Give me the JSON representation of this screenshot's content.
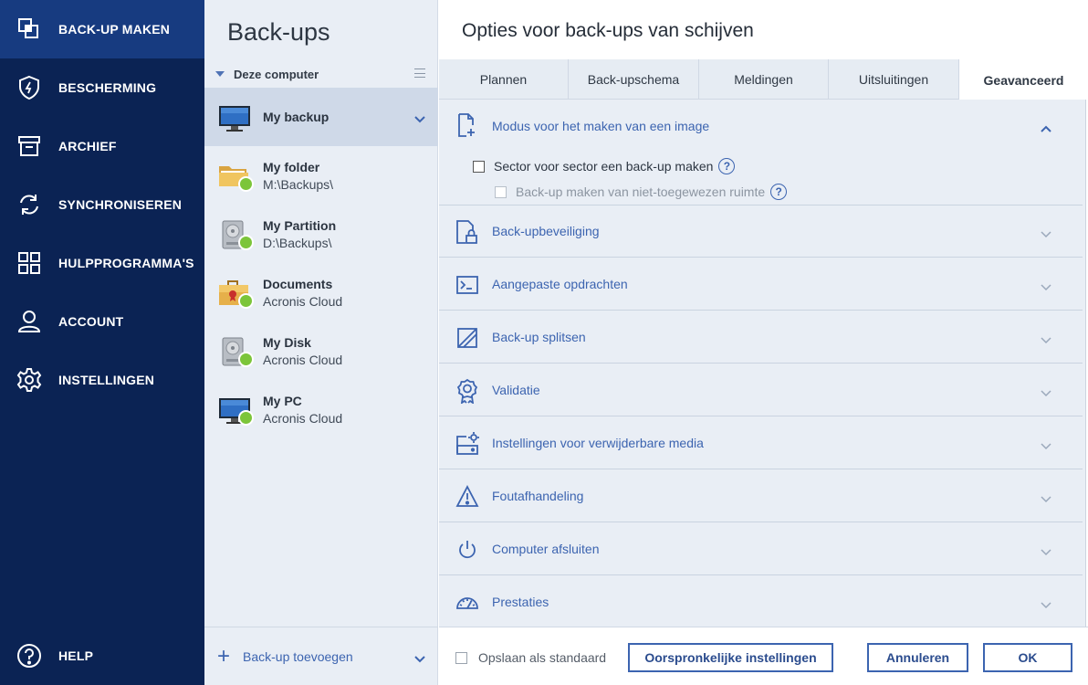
{
  "nav": {
    "items": [
      {
        "label": "BACK-UP MAKEN",
        "icon": "copy-icon",
        "active": true
      },
      {
        "label": "BESCHERMING",
        "icon": "shield-icon",
        "active": false
      },
      {
        "label": "ARCHIEF",
        "icon": "archive-box-icon",
        "active": false
      },
      {
        "label": "SYNCHRONISEREN",
        "icon": "sync-icon",
        "active": false
      },
      {
        "label": "HULPPROGRAMMA'S",
        "icon": "tools-grid-icon",
        "active": false
      },
      {
        "label": "ACCOUNT",
        "icon": "user-icon",
        "active": false
      },
      {
        "label": "INSTELLINGEN",
        "icon": "gear-icon",
        "active": false
      }
    ],
    "help": {
      "label": "HELP",
      "icon": "help-circle-icon"
    }
  },
  "backups": {
    "title": "Back-ups",
    "group": "Deze computer",
    "items": [
      {
        "name": "My backup",
        "sub": "",
        "icon": "monitor-icon",
        "selected": true
      },
      {
        "name": "My folder",
        "sub": "M:\\Backups\\",
        "icon": "folder-icon",
        "selected": false
      },
      {
        "name": "My Partition",
        "sub": "D:\\Backups\\",
        "icon": "disk-icon",
        "selected": false
      },
      {
        "name": "Documents",
        "sub": "Acronis Cloud",
        "icon": "briefcase-icon",
        "selected": false
      },
      {
        "name": "My Disk",
        "sub": "Acronis Cloud",
        "icon": "disk-icon",
        "selected": false
      },
      {
        "name": "My PC",
        "sub": "Acronis Cloud",
        "icon": "monitor-icon",
        "selected": false
      }
    ],
    "add_label": "Back-up toevoegen"
  },
  "options": {
    "title": "Opties voor back-ups van schijven",
    "tabs": [
      {
        "label": "Plannen",
        "active": false
      },
      {
        "label": "Back-upschema",
        "active": false
      },
      {
        "label": "Meldingen",
        "active": false
      },
      {
        "label": "Uitsluitingen",
        "active": false
      },
      {
        "label": "Geavanceerd",
        "active": true
      }
    ],
    "sections": [
      {
        "label": "Modus voor het maken van een image",
        "icon": "image-file-icon",
        "expanded": true
      },
      {
        "label": "Back-upbeveiliging",
        "icon": "lock-file-icon",
        "expanded": false
      },
      {
        "label": "Aangepaste opdrachten",
        "icon": "terminal-icon",
        "expanded": false
      },
      {
        "label": "Back-up splitsen",
        "icon": "split-icon",
        "expanded": false
      },
      {
        "label": "Validatie",
        "icon": "ribbon-badge-icon",
        "expanded": false
      },
      {
        "label": "Instellingen voor verwijderbare media",
        "icon": "removable-media-icon",
        "expanded": false
      },
      {
        "label": "Foutafhandeling",
        "icon": "warning-icon",
        "expanded": false
      },
      {
        "label": "Computer afsluiten",
        "icon": "power-icon",
        "expanded": false
      },
      {
        "label": "Prestaties",
        "icon": "speedometer-icon",
        "expanded": false
      }
    ],
    "image_mode": {
      "sector_label": "Sector voor sector een back-up maken",
      "sector_checked": false,
      "unallocated_label": "Back-up maken van niet-toegewezen ruimte",
      "unallocated_checked": false,
      "unallocated_enabled": false,
      "help_glyph": "?"
    }
  },
  "footer": {
    "save_default_label": "Opslaan als standaard",
    "save_default_checked": false,
    "reset_label": "Oorspronkelijke instellingen",
    "cancel_label": "Annuleren",
    "ok_label": "OK"
  },
  "colors": {
    "nav_bg": "#0b2354",
    "nav_active": "#173b80",
    "accent": "#3c64b0",
    "panel_bg": "#e9eef5",
    "status_ok": "#7cc53a"
  }
}
